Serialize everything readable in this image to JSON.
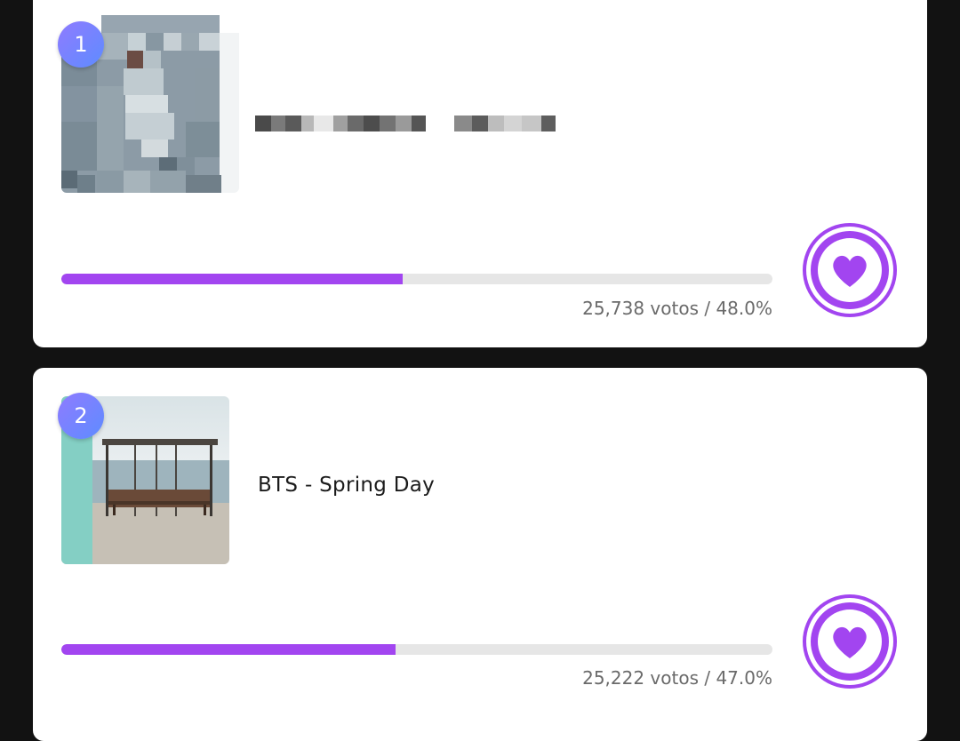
{
  "colors": {
    "background": "#121212",
    "card": "#ffffff",
    "accent": "#a245f0",
    "track": "#e6e6e6",
    "badge_start": "#8f7bff",
    "badge_end": "#5e8cff"
  },
  "entries": [
    {
      "rank": "1",
      "title": "",
      "title_obscured": true,
      "art_obscured": true,
      "votes_text": "25,738 votos / 48.0%",
      "percent": 48.0,
      "vote_icon": "heart-icon"
    },
    {
      "rank": "2",
      "title": "BTS - Spring Day",
      "title_obscured": false,
      "art_obscured": false,
      "votes_text": "25,222 votos / 47.0%",
      "percent": 47.0,
      "vote_icon": "heart-icon"
    }
  ]
}
